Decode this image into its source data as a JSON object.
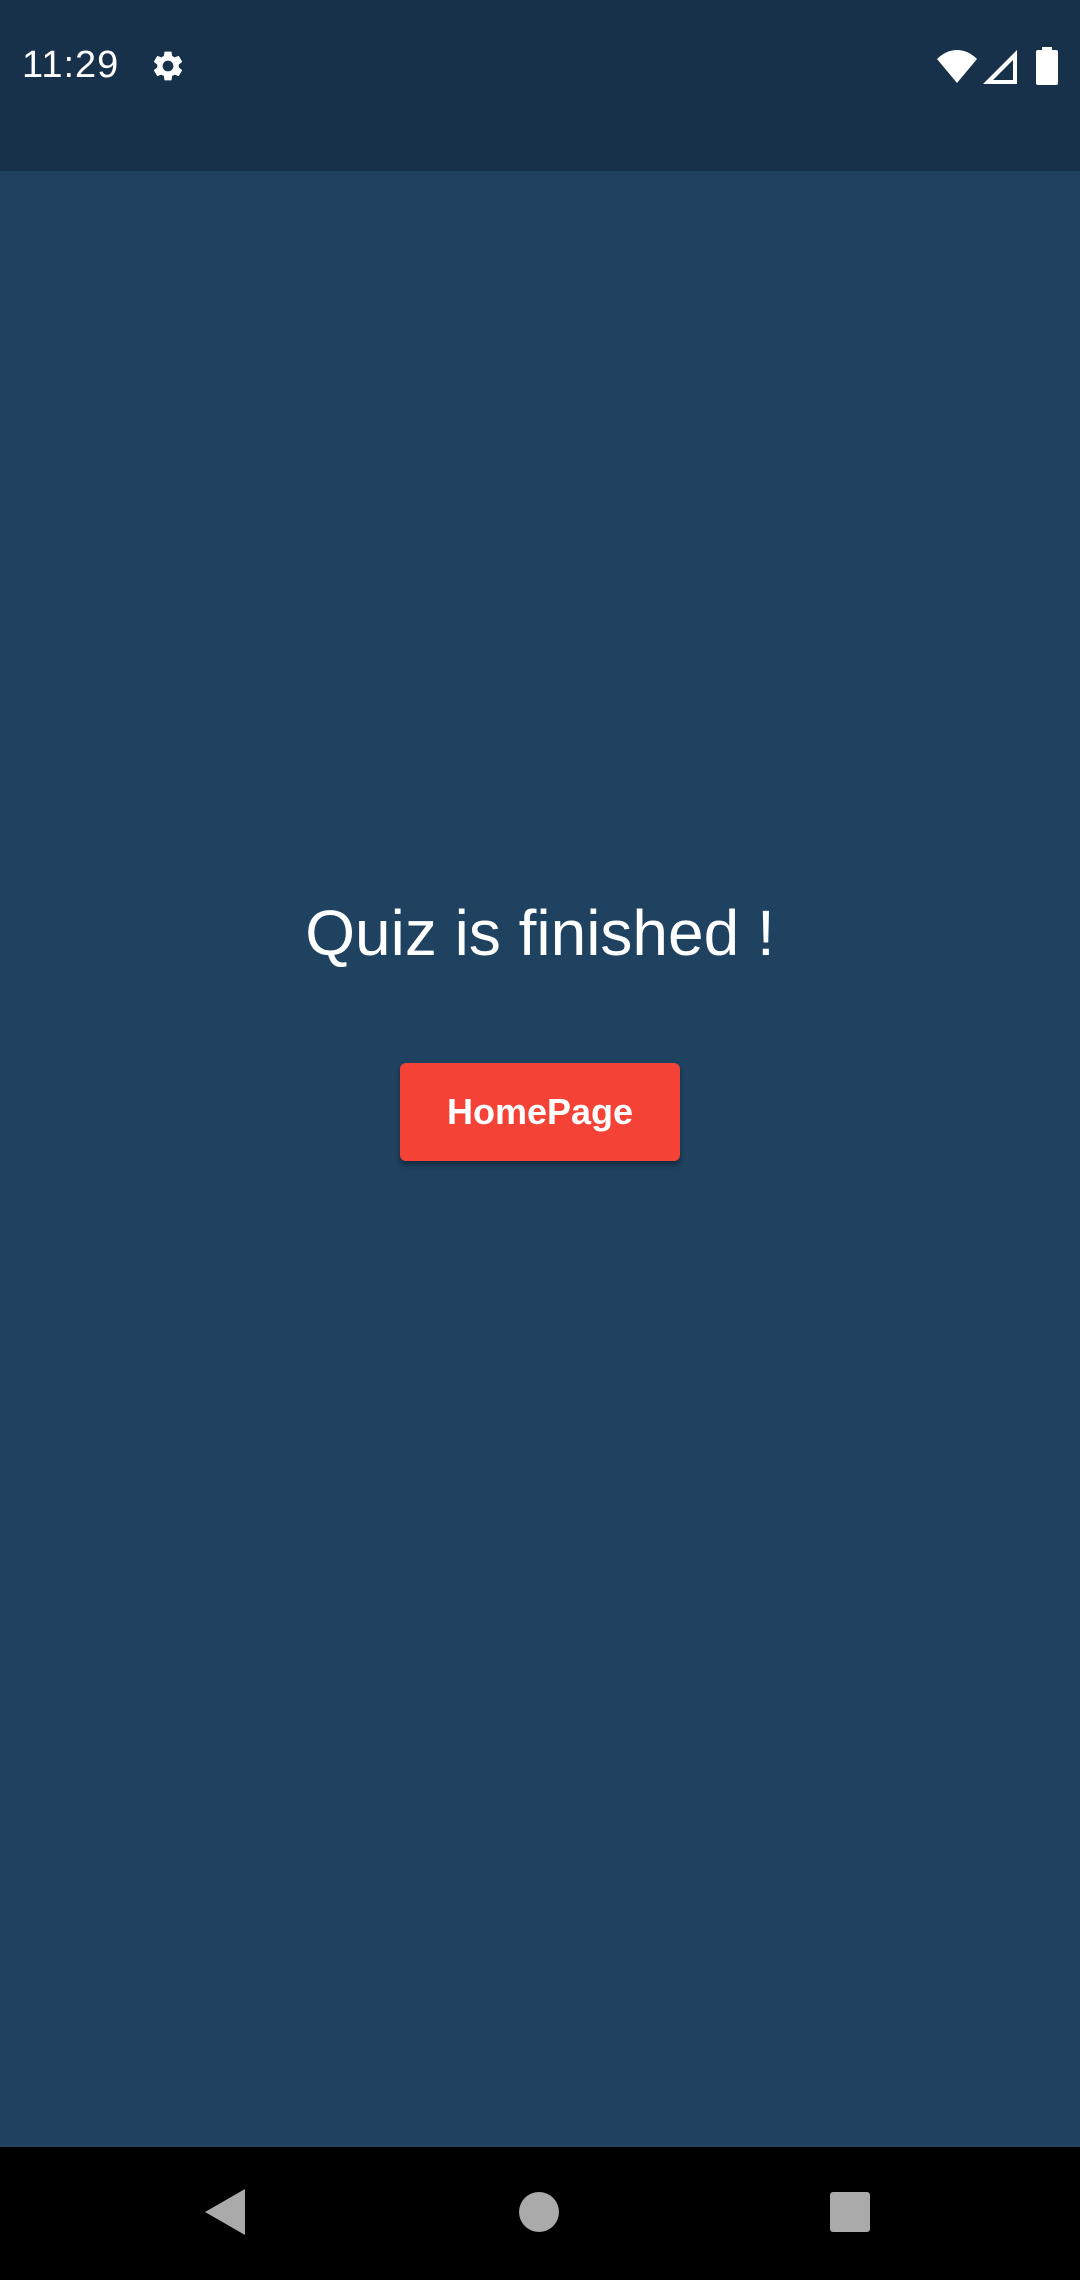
{
  "status_bar": {
    "time": "11:29",
    "icons": [
      "settings-gear-icon",
      "wifi-icon",
      "cell-signal-icon",
      "battery-icon"
    ]
  },
  "main": {
    "message": "Quiz is finished !",
    "home_button_label": "HomePage"
  },
  "nav_bar": {
    "icons": [
      "back-icon",
      "home-icon",
      "recents-icon"
    ]
  },
  "colors": {
    "status_bar_bg": "#18314b",
    "background": "#1f4260",
    "button": "#f44336",
    "text": "#ffffff",
    "nav_bar_bg": "#000000"
  }
}
